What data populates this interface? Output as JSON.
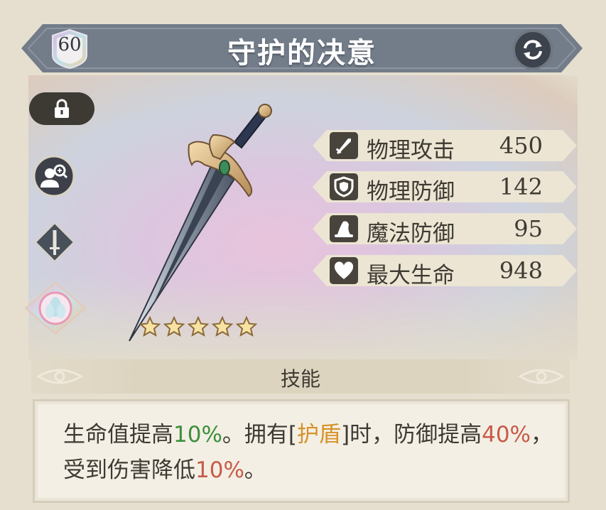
{
  "header": {
    "level": "60",
    "title": "守护的决意"
  },
  "stats": [
    {
      "icon": "sword-icon",
      "name": "物理攻击",
      "value": "450"
    },
    {
      "icon": "shield-icon",
      "name": "物理防御",
      "value": "142"
    },
    {
      "icon": "wizard-hat-icon",
      "name": "魔法防御",
      "value": "95"
    },
    {
      "icon": "heart-icon",
      "name": "最大生命",
      "value": "948"
    }
  ],
  "rarity_stars": 5,
  "skill": {
    "title": "技能",
    "segments": [
      {
        "text": "生命值提高",
        "color": "default"
      },
      {
        "text": "10%",
        "color": "green"
      },
      {
        "text": "。拥有[",
        "color": "default"
      },
      {
        "text": "护盾",
        "color": "orange"
      },
      {
        "text": "]时，防御提高",
        "color": "default"
      },
      {
        "text": "40%",
        "color": "red"
      },
      {
        "text": "，受到伤害降低",
        "color": "default"
      },
      {
        "text": "10%",
        "color": "red"
      },
      {
        "text": "。",
        "color": "default"
      }
    ]
  },
  "colors": {
    "banner": "#737c89",
    "text_dark": "#3e3a33",
    "green": "#3f8f3c",
    "orange": "#d79228",
    "red": "#c85a48"
  }
}
